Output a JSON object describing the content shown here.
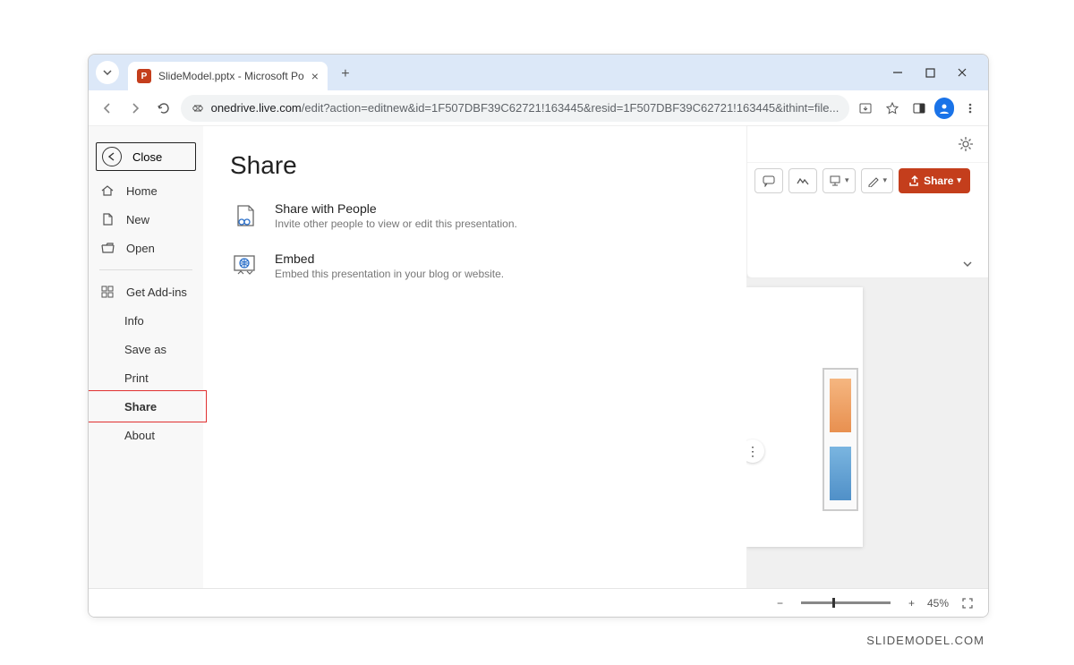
{
  "browser": {
    "tab_title": "SlideModel.pptx - Microsoft Po",
    "url_domain": "onedrive.live.com",
    "url_path": "/edit?action=editnew&id=1F507DBF39C62721!163445&resid=1F507DBF39C62721!163445&ithint=file..."
  },
  "toolbar": {
    "share_label": "Share"
  },
  "backstage": {
    "close": "Close",
    "home": "Home",
    "new": "New",
    "open": "Open",
    "addins": "Get Add-ins",
    "info": "Info",
    "saveas": "Save as",
    "print": "Print",
    "share": "Share",
    "about": "About"
  },
  "share_panel": {
    "title": "Share",
    "opt1_title": "Share with People",
    "opt1_desc": "Invite other people to view or edit this presentation.",
    "opt2_title": "Embed",
    "opt2_desc": "Embed this presentation in your blog or website."
  },
  "status": {
    "zoom": "45%"
  },
  "watermark": "SLIDEMODEL.COM"
}
